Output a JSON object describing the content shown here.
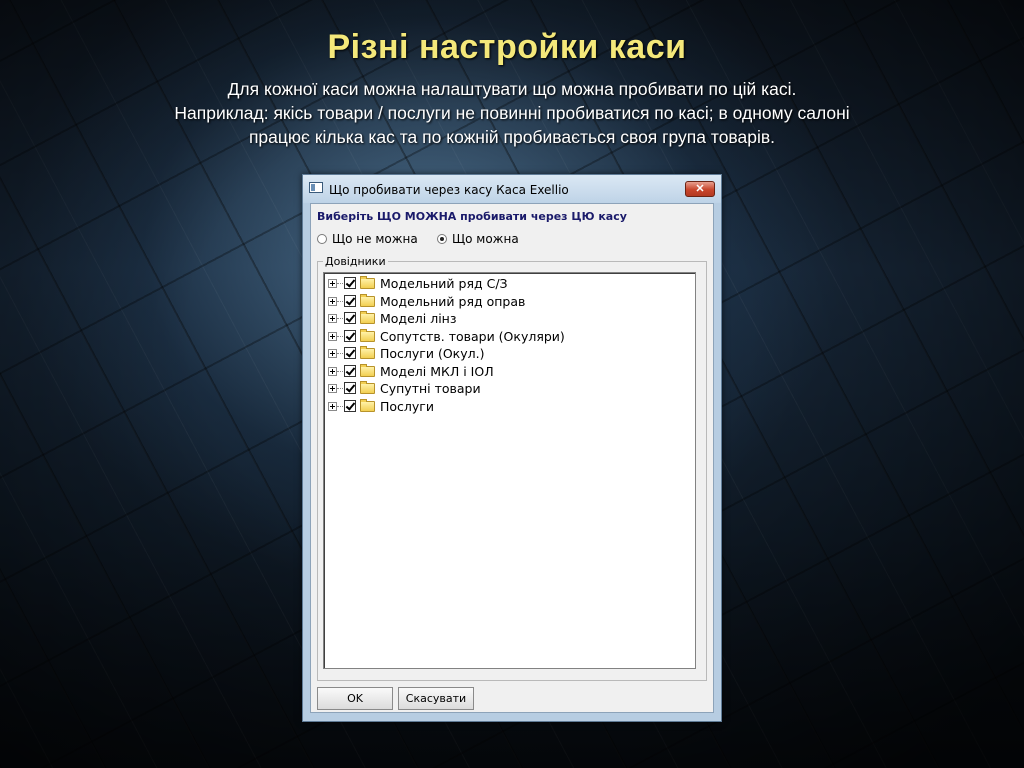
{
  "slide": {
    "title": "Різні настройки каси",
    "subtitle_lines": [
      "Для кожної каси можна налаштувати що можна пробивати по цій касі.",
      "Наприклад: якісь товари / послуги не повинні пробиватися по касі; в одному салоні",
      "працює кілька кас та по кожній пробивається своя група товарів."
    ]
  },
  "dialog": {
    "title": "Що пробивати через касу Каса  Exellio",
    "close_glyph": "✕",
    "heading": "Виберіть ЩО МОЖНА пробивати через ЦЮ касу",
    "radio_options": [
      {
        "label": "Що не можна",
        "selected": false
      },
      {
        "label": "Що можна",
        "selected": true
      }
    ],
    "group_label": "Довідники",
    "tree_items": [
      {
        "label": "Модельний ряд С/З",
        "checked": true,
        "icon": "folder-icon"
      },
      {
        "label": "Модельний ряд оправ",
        "checked": true,
        "icon": "folder-icon"
      },
      {
        "label": "Моделі лінз",
        "checked": true,
        "icon": "folder-icon"
      },
      {
        "label": "Сопутств. товари (Окуляри)",
        "checked": true,
        "icon": "folder-icon"
      },
      {
        "label": "Послуги (Окул.)",
        "checked": true,
        "icon": "folder-icon"
      },
      {
        "label": "Моделі МКЛ і ІОЛ",
        "checked": true,
        "icon": "folder-icon"
      },
      {
        "label": "Супутні товари",
        "checked": true,
        "icon": "folder-icon"
      },
      {
        "label": "Послуги",
        "checked": true,
        "icon": "folder-icon"
      }
    ],
    "ok_label": "OK",
    "cancel_label": "Скасувати"
  },
  "colors": {
    "title_yellow": "#f4e87a",
    "heading_navy": "#1a1a6a",
    "close_red": "#c8452c"
  }
}
